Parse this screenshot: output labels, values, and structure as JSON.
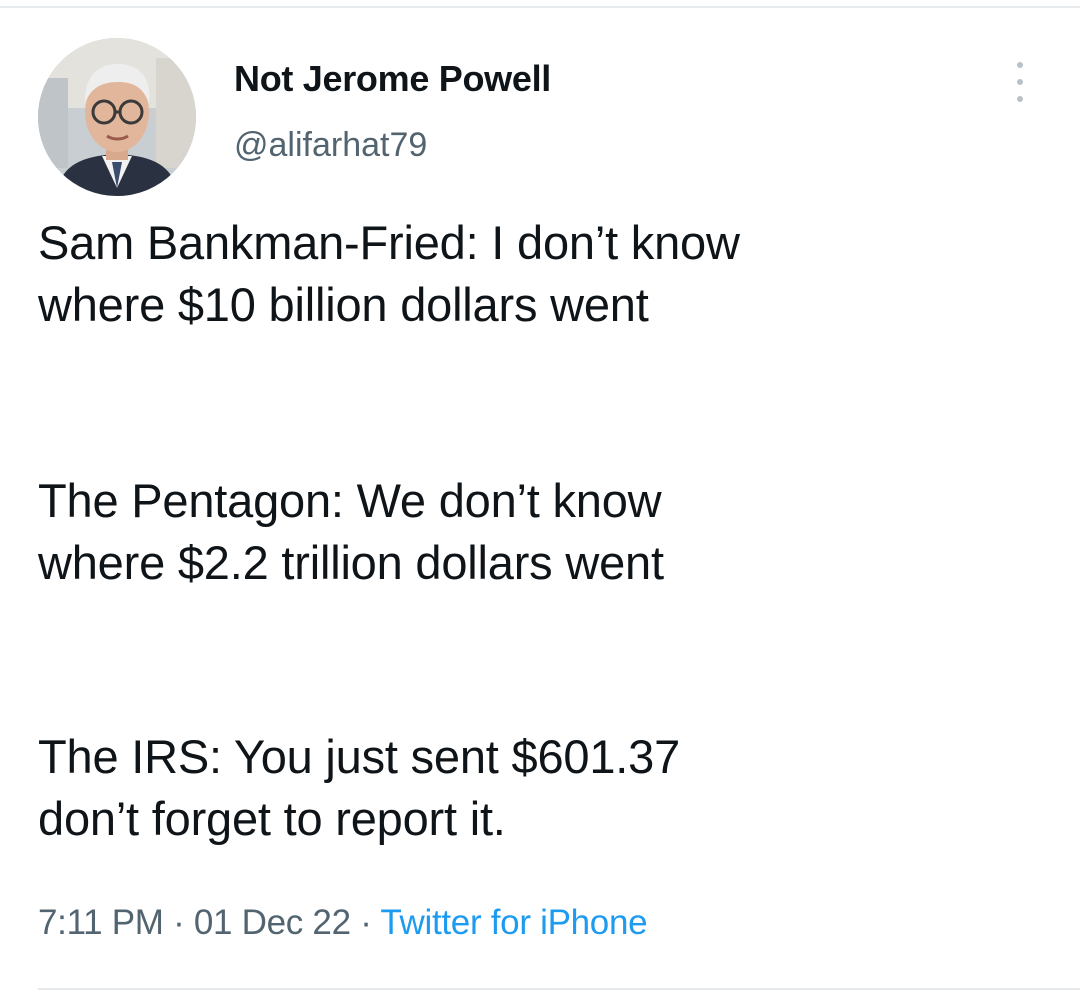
{
  "tweet": {
    "author": {
      "display_name": "Not Jerome Powell",
      "handle": "@alifarhat79",
      "avatar_icon": "profile-photo"
    },
    "more_icon": "more-vertical-icon",
    "text_paragraphs": [
      [
        "Sam Bankman-Fried: I don’t know",
        "where $10 billion dollars went"
      ],
      [
        "The Pentagon: We don’t know",
        "where $2.2 trillion dollars went"
      ],
      [
        "The IRS: You just sent $601.37",
        "don’t forget to report it."
      ]
    ],
    "meta": {
      "time": "7:11 PM",
      "date": "01 Dec 22",
      "separator": "·",
      "source": "Twitter for iPhone"
    }
  },
  "colors": {
    "text": "#0f1419",
    "secondary": "#536471",
    "link": "#1d9bf0"
  }
}
